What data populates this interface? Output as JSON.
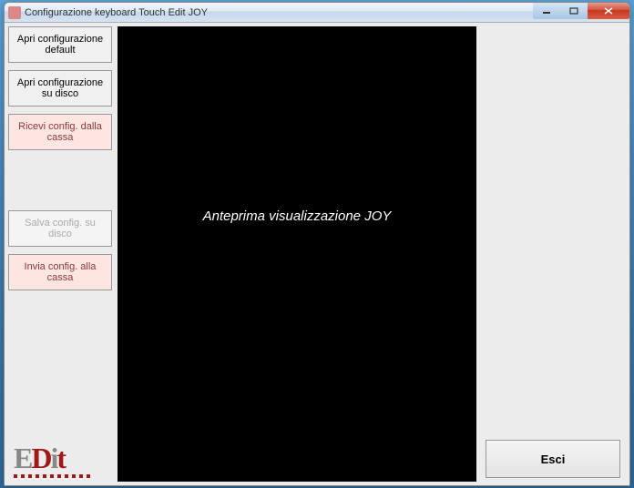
{
  "window": {
    "title": "Configurazione keyboard Touch Edit JOY"
  },
  "sidebar": {
    "btn_open_default": "Apri configurazione default",
    "btn_open_disk": "Apri configurazione su disco",
    "btn_receive": "Ricevi  config. dalla cassa",
    "btn_save_disk": "Salva config. su disco",
    "btn_send": "Invia config. alla cassa"
  },
  "preview": {
    "text": "Anteprima visualizzazione JOY"
  },
  "footer": {
    "exit_label": "Esci"
  },
  "logo": {
    "text_gray": "E",
    "text_red1": "D",
    "text_gray2": "i",
    "text_red2": "t"
  },
  "colors": {
    "accent_red": "#a01818",
    "pink_bg": "#fde5e2"
  }
}
